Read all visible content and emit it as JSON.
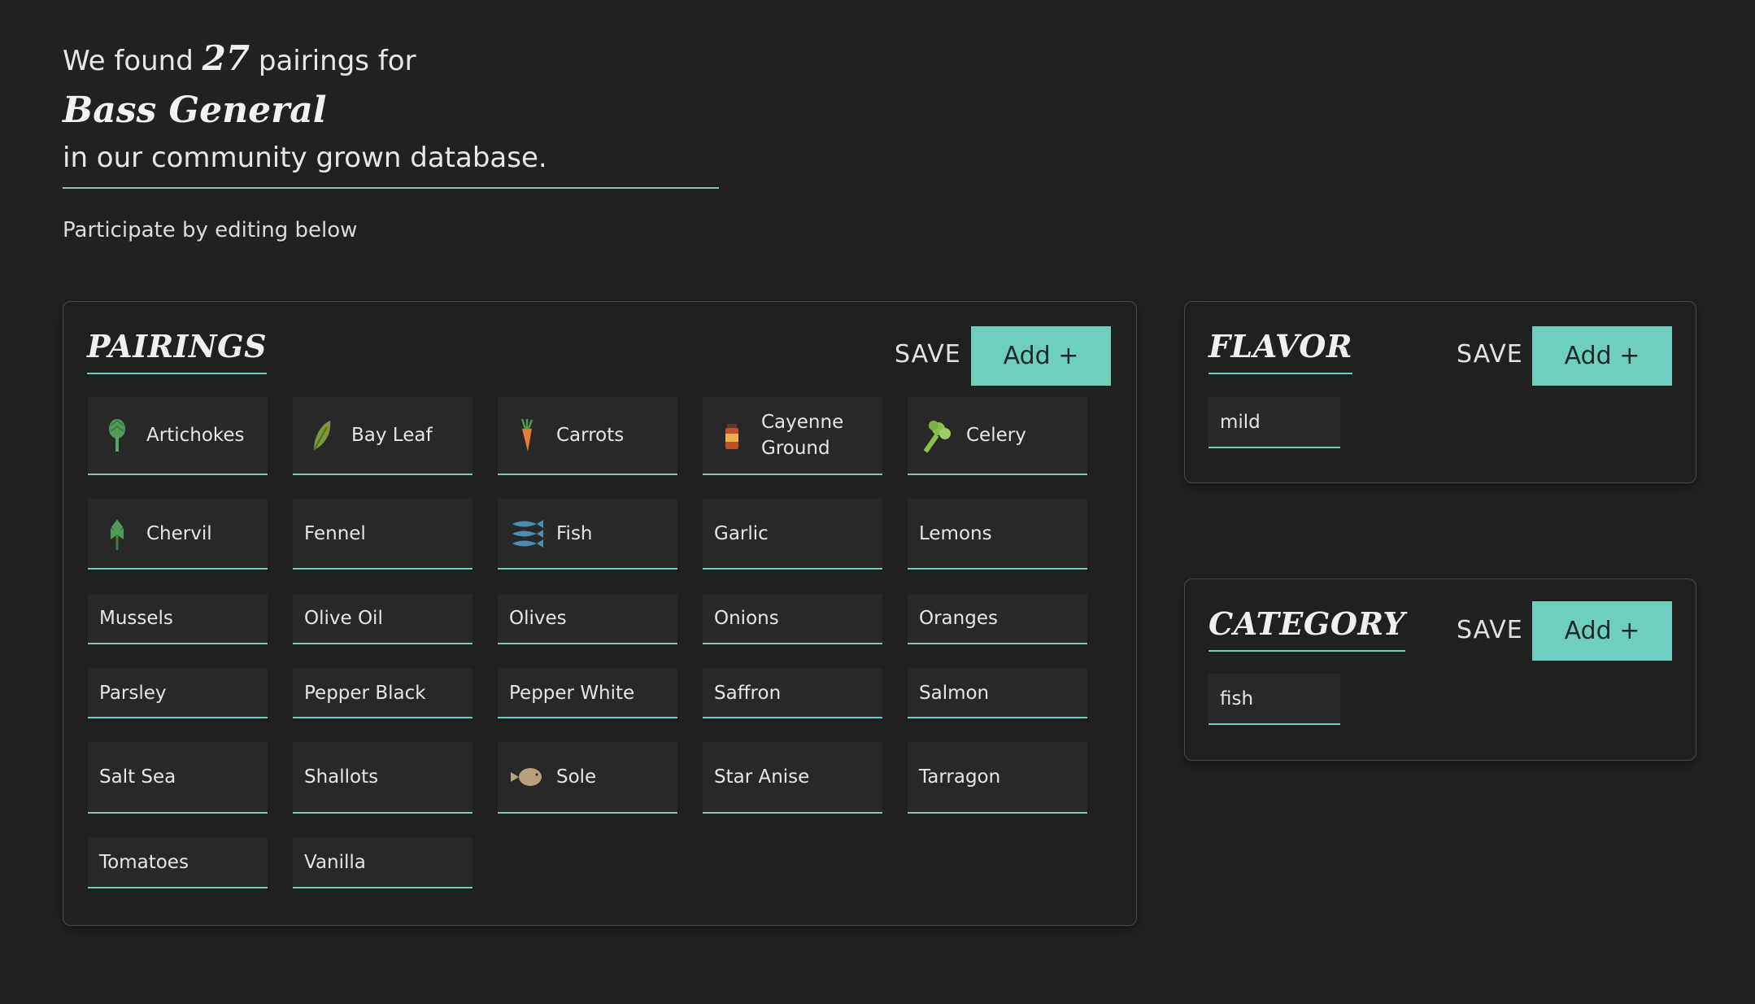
{
  "intro": {
    "prefix": "We found",
    "count": "27",
    "suffix": "pairings for",
    "dish": "Bass General",
    "line3": "in our community grown database.",
    "participate": "Participate by editing below"
  },
  "pairings": {
    "title": "PAIRINGS",
    "save_label": "SAVE",
    "add_label": "Add +",
    "items": [
      {
        "label": "Artichokes",
        "icon": "artichoke-icon"
      },
      {
        "label": "Bay Leaf",
        "icon": "bay-leaf-icon"
      },
      {
        "label": "Carrots",
        "icon": "carrot-icon"
      },
      {
        "label": "Cayenne Ground",
        "icon": "spice-jar-icon"
      },
      {
        "label": "Celery",
        "icon": "celery-icon"
      },
      {
        "label": "Chervil",
        "icon": "herb-icon"
      },
      {
        "label": "Fennel"
      },
      {
        "label": "Fish",
        "icon": "fish-icon"
      },
      {
        "label": "Garlic"
      },
      {
        "label": "Lemons"
      },
      {
        "label": "Mussels"
      },
      {
        "label": "Olive Oil"
      },
      {
        "label": "Olives"
      },
      {
        "label": "Onions"
      },
      {
        "label": "Oranges"
      },
      {
        "label": "Parsley"
      },
      {
        "label": "Pepper Black"
      },
      {
        "label": "Pepper White"
      },
      {
        "label": "Saffron"
      },
      {
        "label": "Salmon"
      },
      {
        "label": "Salt Sea"
      },
      {
        "label": "Shallots"
      },
      {
        "label": "Sole",
        "icon": "sole-fish-icon"
      },
      {
        "label": "Star Anise"
      },
      {
        "label": "Tarragon"
      },
      {
        "label": "Tomatoes"
      },
      {
        "label": "Vanilla"
      }
    ]
  },
  "flavor": {
    "title": "FLAVOR",
    "save_label": "SAVE",
    "add_label": "Add +",
    "items": [
      {
        "label": "mild"
      }
    ]
  },
  "category": {
    "title": "CATEGORY",
    "save_label": "SAVE",
    "add_label": "Add +",
    "items": [
      {
        "label": "fish"
      }
    ]
  },
  "colors": {
    "background": "#212121",
    "accent": "#6fcfbf",
    "chip": "#282828"
  }
}
